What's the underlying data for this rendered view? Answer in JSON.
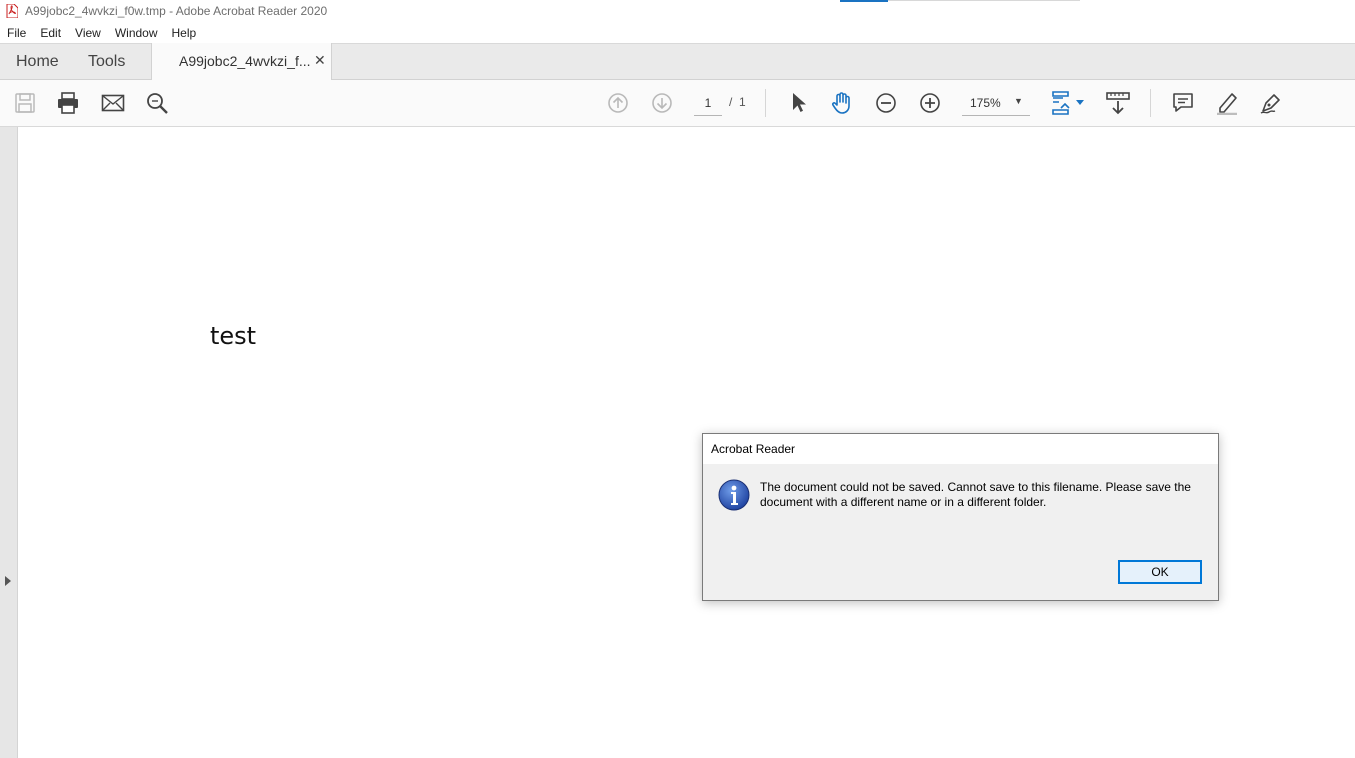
{
  "window": {
    "title": "A99jobc2_4wvkzi_f0w.tmp - Adobe Acrobat Reader 2020",
    "icon": "pdf-file-icon"
  },
  "menubar": {
    "items": [
      "File",
      "Edit",
      "View",
      "Window",
      "Help"
    ]
  },
  "tabs": {
    "home": "Home",
    "tools": "Tools",
    "document": "A99jobc2_4wvkzi_f...",
    "close": "✕"
  },
  "toolbar": {
    "left_icons": [
      "save-icon",
      "print-icon",
      "email-icon",
      "search-icon"
    ],
    "page_current": "1",
    "page_separator": "/",
    "page_total": "1",
    "zoom": "175%",
    "zoom_caret": "▼",
    "right_icons": [
      "scroll-up-icon",
      "scroll-down-icon",
      "select-arrow-icon",
      "hand-icon",
      "zoom-out-icon",
      "zoom-in-icon",
      "page-display-icon",
      "read-mode-icon",
      "comment-icon",
      "highlight-icon",
      "sign-icon"
    ],
    "accent_color": "#1a73c2"
  },
  "document": {
    "text": "test"
  },
  "dialog": {
    "title": "Acrobat Reader",
    "icon": "info-icon",
    "message": "The document could not be saved. Cannot save to this filename. Please save the document with a different name or in a different folder.",
    "ok_label": "OK"
  }
}
